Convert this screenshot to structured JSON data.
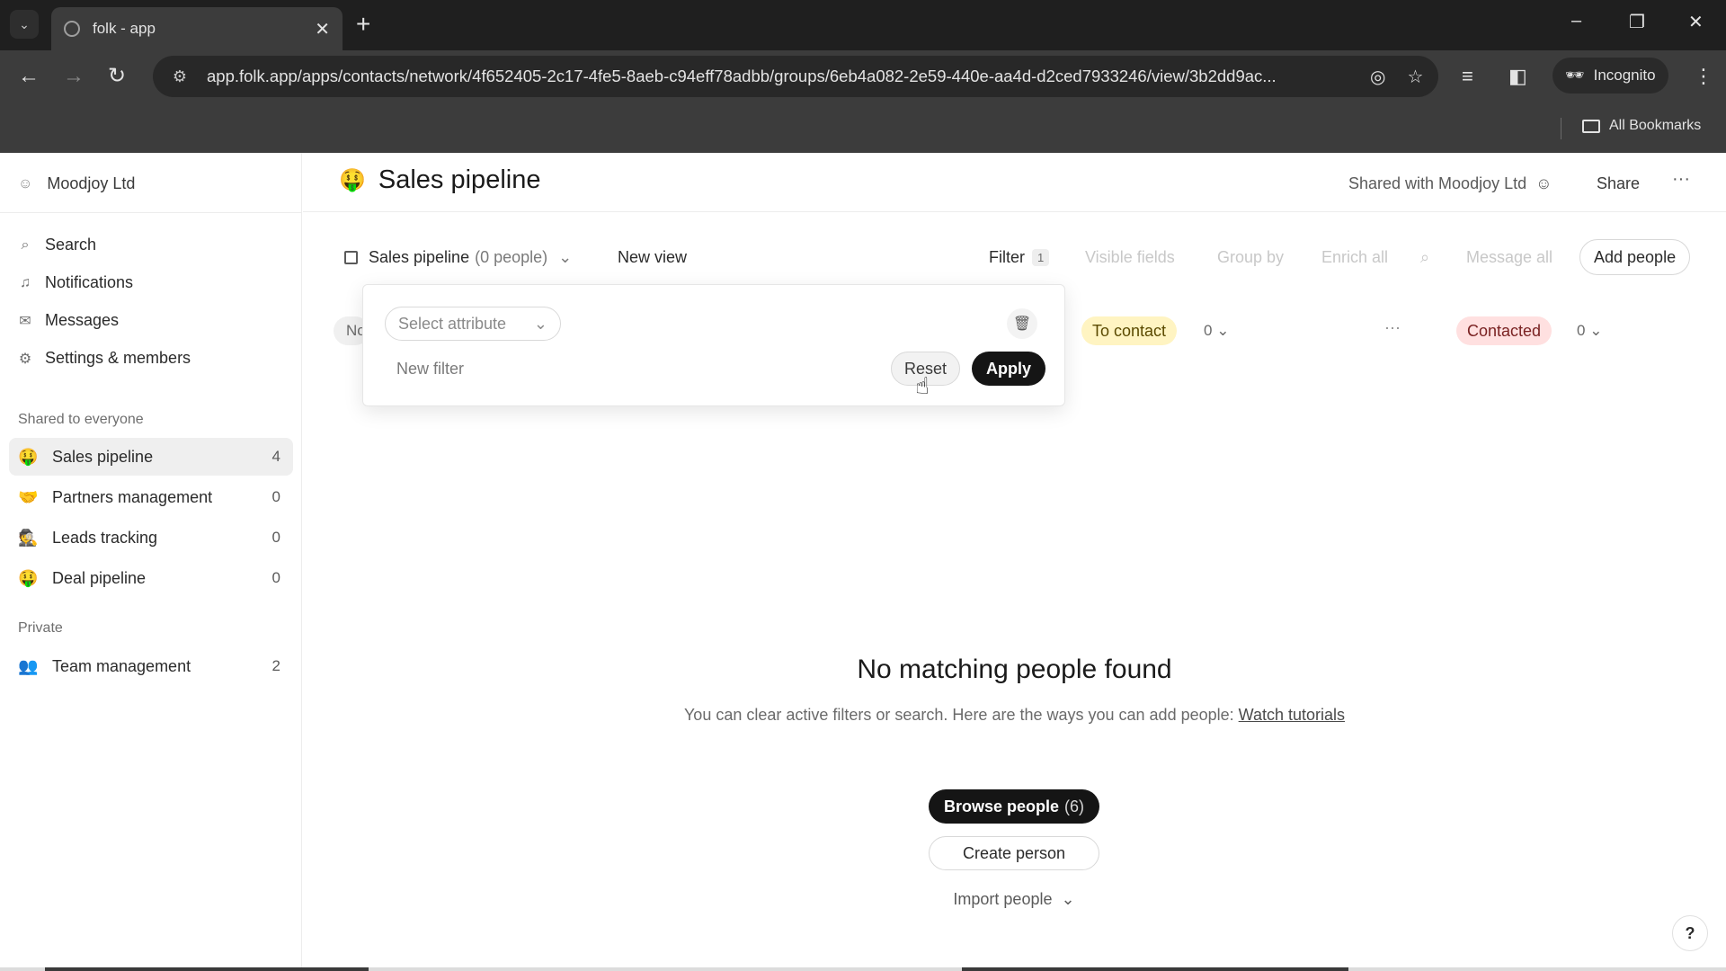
{
  "browser": {
    "tab_title": "folk - app",
    "url": "app.folk.app/apps/contacts/network/4f652405-2c17-4fe5-8aeb-c94eff78adbb/groups/6eb4a082-2e59-440e-aa4d-d2ced7933246/view/3b2dd9ac...",
    "incognito_label": "Incognito",
    "bookmarks_label": "All Bookmarks"
  },
  "sidebar": {
    "workspace": "Moodjoy Ltd",
    "nav": [
      {
        "label": "Search",
        "icon": "search-icon"
      },
      {
        "label": "Notifications",
        "icon": "bell-icon"
      },
      {
        "label": "Messages",
        "icon": "mail-icon"
      },
      {
        "label": "Settings & members",
        "icon": "gear-icon"
      }
    ],
    "shared_heading": "Shared to everyone",
    "shared_groups": [
      {
        "emoji": "🤑",
        "label": "Sales pipeline",
        "count": "4"
      },
      {
        "emoji": "🤝",
        "label": "Partners management",
        "count": "0"
      },
      {
        "emoji": "🕵️",
        "label": "Leads tracking",
        "count": "0"
      },
      {
        "emoji": "🤑",
        "label": "Deal pipeline",
        "count": "0"
      }
    ],
    "private_heading": "Private",
    "private_groups": [
      {
        "emoji": "👥",
        "label": "Team management",
        "count": "2"
      }
    ]
  },
  "header": {
    "emoji": "🤑",
    "title": "Sales pipeline",
    "shared_with": "Shared with Moodjoy Ltd",
    "share_label": "Share",
    "more_label": "···"
  },
  "viewbar": {
    "view_name": "Sales pipeline",
    "view_count": "(0 people)",
    "new_view": "New view",
    "filter_label": "Filter",
    "filter_count": "1",
    "visible_fields": "Visible fields",
    "group_by": "Group by",
    "enrich_all": "Enrich all",
    "message_all": "Message all",
    "add_people": "Add people"
  },
  "board": {
    "ghost_tag": "No",
    "stages": [
      {
        "label": "To contact",
        "count": "0"
      },
      {
        "label": "Contacted",
        "count": "0"
      }
    ],
    "column_more": "···"
  },
  "filter_popover": {
    "select_placeholder": "Select attribute",
    "new_filter": "New filter",
    "reset_label": "Reset",
    "apply_label": "Apply"
  },
  "empty_state": {
    "title": "No matching people found",
    "text": "You can clear active filters or search. Here are the ways you can add people:",
    "link": "Watch tutorials",
    "browse_label": "Browse people",
    "browse_count": "(6)",
    "create_label": "Create person",
    "import_label": "Import people"
  },
  "help_label": "?"
}
